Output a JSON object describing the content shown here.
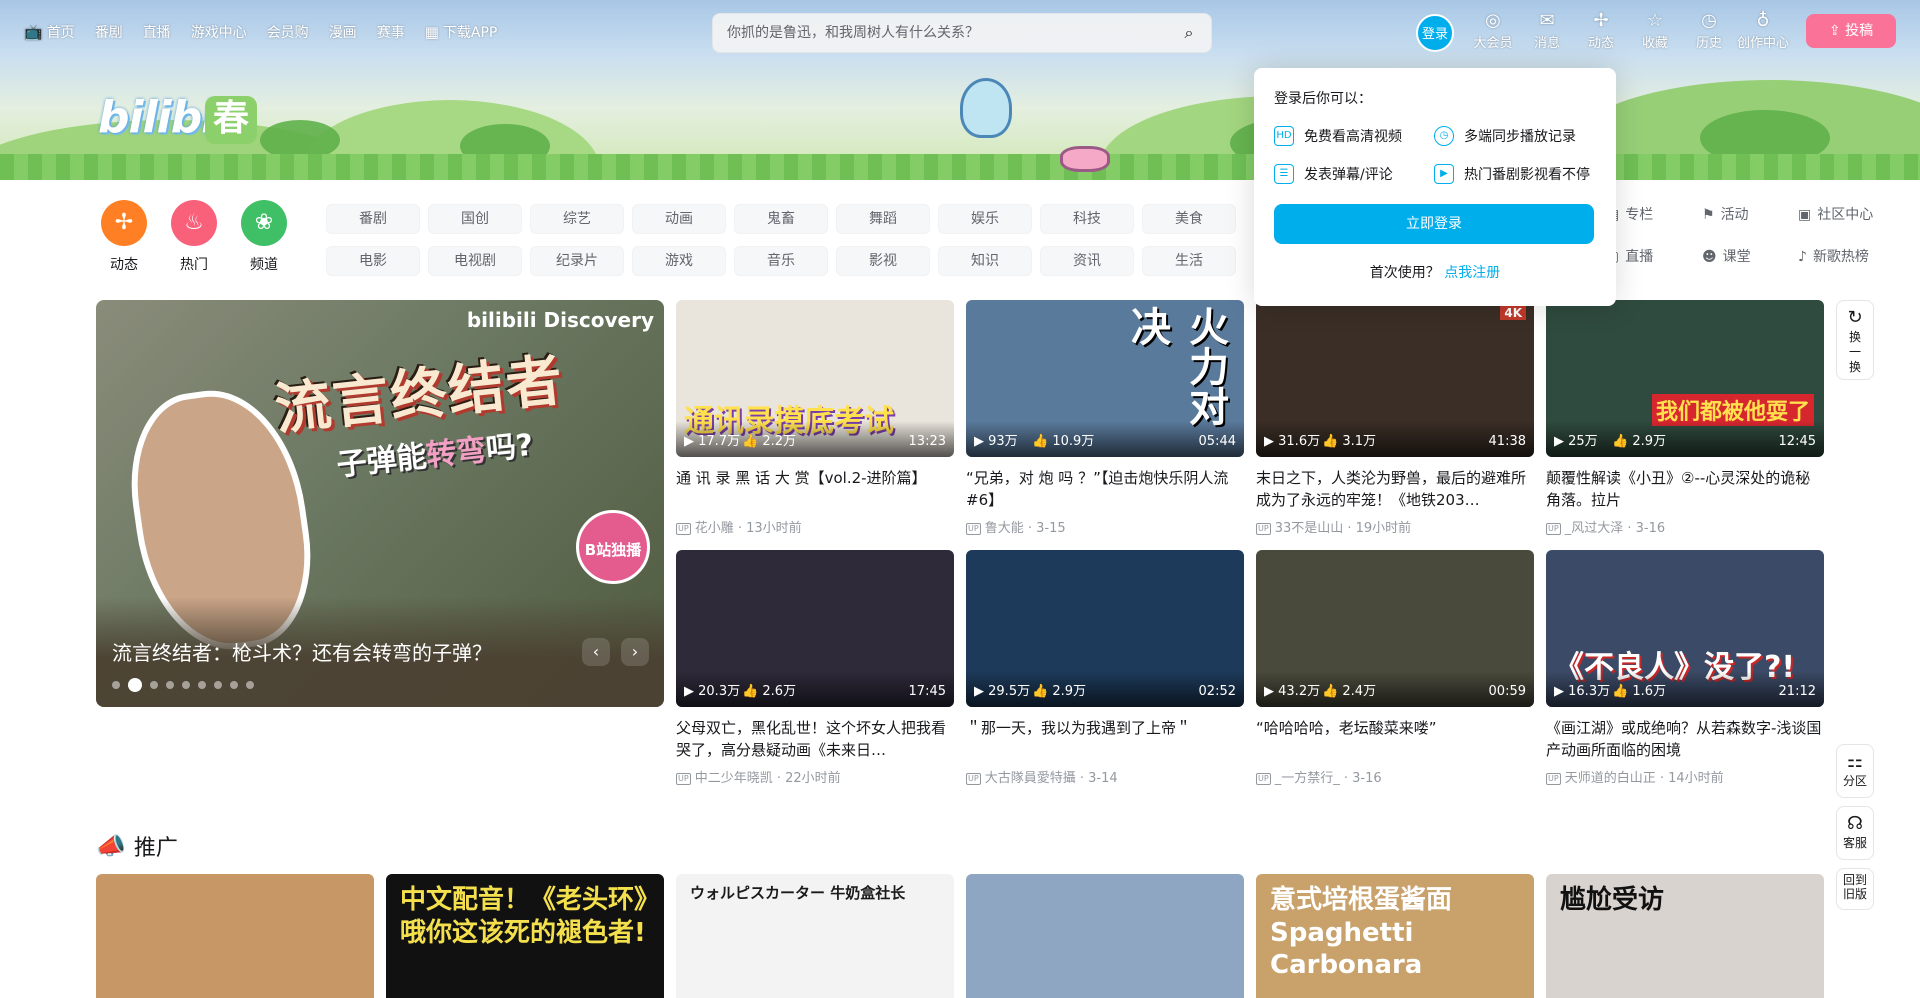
{
  "topnav": {
    "left": [
      {
        "label": "首页",
        "icon": "tv-icon"
      },
      {
        "label": "番剧"
      },
      {
        "label": "直播"
      },
      {
        "label": "游戏中心"
      },
      {
        "label": "会员购"
      },
      {
        "label": "漫画"
      },
      {
        "label": "赛事"
      },
      {
        "label": "下载APP",
        "icon": "app-grid-icon"
      }
    ],
    "search_placeholder": "你抓的是鲁迅，和我周树人有什么关系？",
    "login": "登录",
    "right": [
      {
        "label": "大会员",
        "icon": "vip-icon"
      },
      {
        "label": "消息",
        "icon": "mail-icon"
      },
      {
        "label": "动态",
        "icon": "fan-icon"
      },
      {
        "label": "收藏",
        "icon": "star-icon"
      },
      {
        "label": "历史",
        "icon": "clock-icon"
      },
      {
        "label": "创作中心",
        "icon": "bulb-icon"
      }
    ],
    "upload": "投稿"
  },
  "brand": {
    "logo": "bilibili",
    "season": "春"
  },
  "channels": {
    "big": [
      {
        "label": "动态",
        "color": "#ff7f24"
      },
      {
        "label": "热门",
        "color": "#f9617a"
      },
      {
        "label": "频道",
        "color": "#3fbf66"
      }
    ],
    "row1": [
      "番剧",
      "国创",
      "综艺",
      "动画",
      "鬼畜",
      "舞蹈",
      "娱乐",
      "科技",
      "美食"
    ],
    "row2": [
      "电影",
      "电视剧",
      "纪录片",
      "游戏",
      "音乐",
      "影视",
      "知识",
      "资讯",
      "生活"
    ],
    "extra": [
      {
        "label": "专栏",
        "icon": "article-icon"
      },
      {
        "label": "活动",
        "icon": "flag-icon"
      },
      {
        "label": "社区中心",
        "icon": "community-icon"
      },
      {
        "label": "直播",
        "icon": "live-icon"
      },
      {
        "label": "课堂",
        "icon": "class-icon"
      },
      {
        "label": "新歌热榜",
        "icon": "music-chart-icon"
      }
    ]
  },
  "login_popup": {
    "title": "登录后你可以：",
    "features": [
      "免费看高清视频",
      "多端同步播放记录",
      "发表弹幕/评论",
      "热门番剧影视看不停"
    ],
    "button": "立即登录",
    "register_prompt": "首次使用？",
    "register_link": "点我注册"
  },
  "carousel": {
    "caption": "流言终结者：枪斗术？还有会转弯的子弹？",
    "brand": "bilibili Discovery",
    "art_title": "流言终结者",
    "art_sub_pre": "子弹能",
    "art_sub_hl": "转弯",
    "art_sub_post": "吗?",
    "badge": "B站独播",
    "prev": "‹",
    "next": "›",
    "active_dot": 2
  },
  "videos": [
    {
      "title": "通 讯 录 黑 话 大 赏【vol.2-进阶篇】",
      "plays": "17.7万",
      "likes": "2.2万",
      "duration": "13:23",
      "author": "花小雕",
      "date": "13小时前",
      "thumb_text": "通讯录摸底考试",
      "bg": "#e9e4dc"
    },
    {
      "title": "“兄弟，对 炮 吗 ？”【迫击炮快乐阴人流#6】",
      "plays": "93万",
      "likes": "10.9万",
      "duration": "05:44",
      "author": "鲁大能",
      "date": "3-15",
      "thumb_text": "火力对决",
      "bg": "#5a7a9c"
    },
    {
      "title": "末日之下，人类沦为野兽，最后的避难所成为了永远的牢笼！《地铁203…",
      "plays": "31.6万",
      "likes": "3.1万",
      "duration": "41:38",
      "author": "33不是山山",
      "date": "19小时前",
      "thumb_text": "4K",
      "bg": "#3a2e26"
    },
    {
      "title": "颠覆性解读《小丑》②--心灵深处的诡秘角落。拉片",
      "plays": "25万",
      "likes": "2.9万",
      "duration": "12:45",
      "author": "_风过大泽",
      "date": "3-16",
      "thumb_text": "我们都被他耍了",
      "bg": "#2f4a3e"
    },
    {
      "title": "父母双亡，黑化乱世！这个坏女人把我看哭了，高分悬疑动画《未来日…",
      "plays": "20.3万",
      "likes": "2.6万",
      "duration": "17:45",
      "author": "中二少年晓凯",
      "date": "22小时前",
      "thumb_text": "",
      "bg": "#2e2a3a"
    },
    {
      "title": "＂那一天，我以为我遇到了上帝＂",
      "plays": "29.5万",
      "likes": "2.9万",
      "duration": "02:52",
      "author": "大古隊員愛特攝",
      "date": "3-14",
      "thumb_text": "",
      "bg": "#1d3a5a"
    },
    {
      "title": "“哈哈哈哈，老坛酸菜来喽”",
      "plays": "43.2万",
      "likes": "2.4万",
      "duration": "00:59",
      "author": "_一方禁行_",
      "date": "3-16",
      "thumb_text": "",
      "bg": "#4a4a3c"
    },
    {
      "title": "《画江湖》或成绝响？从若森数字-浅谈国产动画所面临的困境",
      "plays": "16.3万",
      "likes": "1.6万",
      "duration": "21:12",
      "author": "天师道的白山正",
      "date": "14小时前",
      "thumb_text": "《不良人》没了?!",
      "bg": "#3b4a66"
    }
  ],
  "side": [
    {
      "label": "换一换",
      "icon": "refresh-icon"
    },
    {
      "label": "分区",
      "icon": "grid-icon"
    },
    {
      "label": "客服",
      "icon": "headset-icon"
    },
    {
      "label": "回到旧版",
      "icon": ""
    }
  ],
  "promo": {
    "heading": "推广",
    "items": [
      {
        "text": "",
        "bg": "#c79766"
      },
      {
        "text": "中文配音！《老头环》哦你这该死的褪色者!",
        "bg": "#111111"
      },
      {
        "text": "ウォルピスカーター 牛奶盒社长",
        "bg": "#f3f3f3"
      },
      {
        "text": "",
        "bg": "#8fa6c2"
      },
      {
        "text": "意式培根蛋酱面 Spaghetti Carbonara",
        "bg": "#c9a16b"
      },
      {
        "text": "尴尬受访",
        "bg": "#d9d3cf"
      }
    ]
  },
  "colors": {
    "accent": "#00aeec",
    "pink": "#fb7299"
  }
}
